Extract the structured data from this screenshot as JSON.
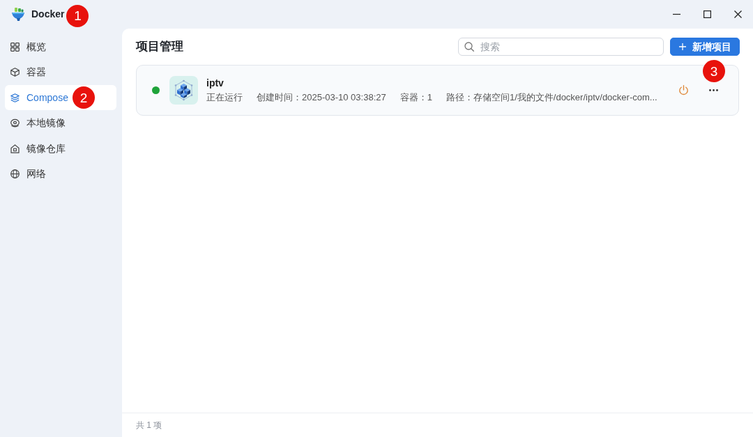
{
  "window": {
    "title": "Docker",
    "callout": "1"
  },
  "sidebar": {
    "items": [
      {
        "label": "概览",
        "selected": false
      },
      {
        "label": "容器",
        "selected": false
      },
      {
        "label": "Compose",
        "selected": true,
        "callout": "2"
      },
      {
        "label": "本地镜像",
        "selected": false
      },
      {
        "label": "镜像仓库",
        "selected": false
      },
      {
        "label": "网络",
        "selected": false
      }
    ]
  },
  "main": {
    "title": "项目管理",
    "search": {
      "placeholder": "搜索"
    },
    "add_button": {
      "label": "新增项目",
      "callout": "3"
    },
    "projects": [
      {
        "name": "iptv",
        "running": true,
        "status": "正在运行",
        "created": "创建时间：2025-03-10 03:38:27",
        "containers": "容器：1",
        "path": "路径：存储空间1/我的文件/docker/iptv/docker-com..."
      }
    ],
    "footer": "共 1 项"
  }
}
